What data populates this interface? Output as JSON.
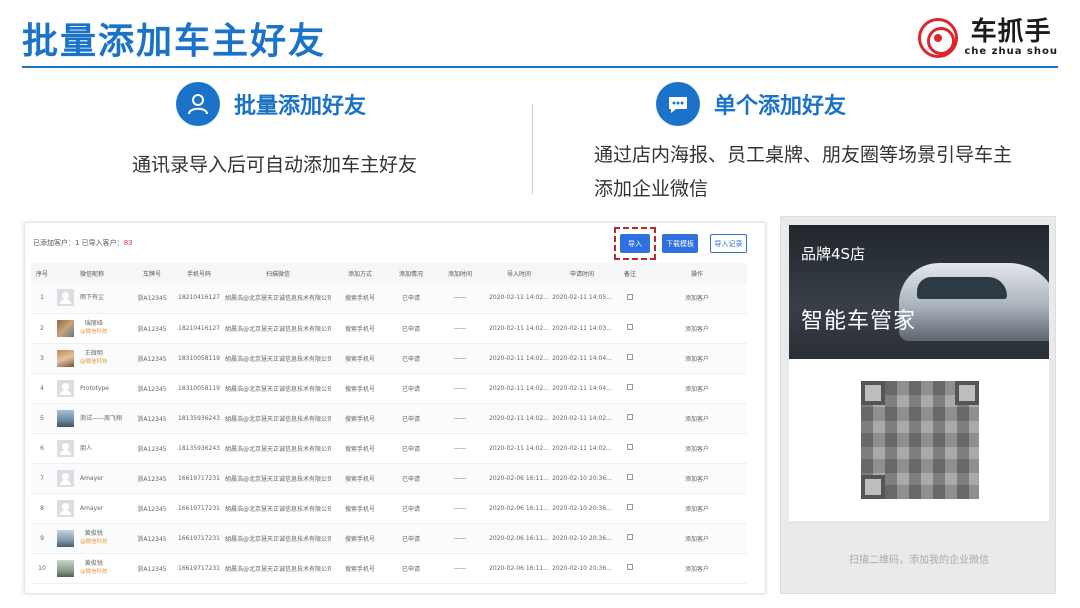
{
  "page": {
    "title": "批量添加车主好友"
  },
  "logo": {
    "name_cn": "车抓手",
    "name_en": "che zhua shou"
  },
  "features": {
    "left": {
      "title": "批量添加好友",
      "icon": "user-icon",
      "description": "通讯录导入后可自动添加车主好友"
    },
    "right": {
      "title": "单个添加好友",
      "icon": "chat-bubble-icon",
      "description": "通过店内海报、员工桌牌、朋友圈等场景引导车主添加企业微信"
    }
  },
  "panel": {
    "summary_prefix": "已添加客户：1 已导入客户：",
    "summary_count": "83",
    "buttons": {
      "import": "导入",
      "download_template": "下载模板",
      "import_record": "导入记录"
    },
    "columns": [
      "序号",
      "微信昵称",
      "车牌号",
      "手机号码",
      "扫描微信",
      "添加方式",
      "添加情况",
      "添加时间",
      "导入时间",
      "申请时间",
      "备注",
      "操作"
    ],
    "rows": [
      {
        "no": "1",
        "nickname": "雨下有尘",
        "tag": "",
        "avatar": "default",
        "plate": "浙A12345",
        "phone": "18210416127",
        "scan": "胡晨浩@北京慧天正诚信息技术有限公司",
        "method": "搜索手机号",
        "status": "已申请",
        "added": "——",
        "imported": "2020-02-11 14:02...",
        "applied": "2020-02-11 14:05...",
        "action": "添加客户"
      },
      {
        "no": "2",
        "nickname": "瑞丽娅",
        "tag": "@微信科技",
        "avatar": "photo",
        "plate": "浙A12345",
        "phone": "18210416127",
        "scan": "胡晨浩@北京慧天正诚信息技术有限公司",
        "method": "搜索手机号",
        "status": "已申请",
        "added": "——",
        "imported": "2020-02-11 14:02...",
        "applied": "2020-02-11 14:03...",
        "action": "添加客户"
      },
      {
        "no": "3",
        "nickname": "王微明",
        "tag": "@微信科技",
        "avatar": "photo2",
        "plate": "浙A12345",
        "phone": "18310058119",
        "scan": "胡晨浩@北京慧天正诚信息技术有限公司",
        "method": "搜索手机号",
        "status": "已申请",
        "added": "——",
        "imported": "2020-02-11 14:02...",
        "applied": "2020-02-11 14:04...",
        "action": "添加客户"
      },
      {
        "no": "4",
        "nickname": "Prototype",
        "tag": "",
        "avatar": "default",
        "plate": "浙A12345",
        "phone": "18310058119",
        "scan": "胡晨浩@北京慧天正诚信息技术有限公司",
        "method": "搜索手机号",
        "status": "已申请",
        "added": "——",
        "imported": "2020-02-11 14:02...",
        "applied": "2020-02-11 14:04...",
        "action": "添加客户"
      },
      {
        "no": "5",
        "nickname": "测试——周飞翔",
        "tag": "",
        "avatar": "photo3",
        "plate": "浙A12345",
        "phone": "18135936243",
        "scan": "胡晨浩@北京慧天正诚信息技术有限公司",
        "method": "搜索手机号",
        "status": "已申请",
        "added": "——",
        "imported": "2020-02-11 14:02...",
        "applied": "2020-02-11 14:02...",
        "action": "添加客户"
      },
      {
        "no": "6",
        "nickname": "朋人",
        "tag": "",
        "avatar": "default",
        "plate": "浙A12345",
        "phone": "18135936243",
        "scan": "胡晨浩@北京慧天正诚信息技术有限公司",
        "method": "搜索手机号",
        "status": "已申请",
        "added": "——",
        "imported": "2020-02-11 14:02...",
        "applied": "2020-02-11 14:02...",
        "action": "添加客户"
      },
      {
        "no": "7",
        "nickname": "Amayer",
        "tag": "",
        "avatar": "default",
        "plate": "浙A12345",
        "phone": "16619717231",
        "scan": "胡晨浩@北京慧天正诚信息技术有限公司",
        "method": "搜索手机号",
        "status": "已申请",
        "added": "——",
        "imported": "2020-02-06 16:11...",
        "applied": "2020-02-10 20:36...",
        "action": "添加客户"
      },
      {
        "no": "8",
        "nickname": "Amayer",
        "tag": "",
        "avatar": "default",
        "plate": "浙A12345",
        "phone": "16619717231",
        "scan": "胡晨浩@北京慧天正诚信息技术有限公司",
        "method": "搜索手机号",
        "status": "已申请",
        "added": "——",
        "imported": "2020-02-06 16:11...",
        "applied": "2020-02-10 20:36...",
        "action": "添加客户"
      },
      {
        "no": "9",
        "nickname": "黄俊锐",
        "tag": "@微信科技",
        "avatar": "photo4",
        "plate": "浙A12345",
        "phone": "16619717231",
        "scan": "胡晨浩@北京慧天正诚信息技术有限公司",
        "method": "搜索手机号",
        "status": "已申请",
        "added": "——",
        "imported": "2020-02-06 16:11...",
        "applied": "2020-02-10 20:36...",
        "action": "添加客户"
      },
      {
        "no": "10",
        "nickname": "黄俊锐",
        "tag": "@微信科技",
        "avatar": "photo5",
        "plate": "浙A12345",
        "phone": "16619717231",
        "scan": "胡晨浩@北京慧天正诚信息技术有限公司",
        "method": "搜索手机号",
        "status": "已申请",
        "added": "——",
        "imported": "2020-02-06 16:11...",
        "applied": "2020-02-10 20:36...",
        "action": "添加客户"
      }
    ]
  },
  "qr_card": {
    "brand_line": "品牌4S店",
    "banner_title": "智能车管家",
    "caption": "扫描二维码，添加我的企业微信"
  },
  "colors": {
    "accent": "#1a73c8",
    "button": "#2f6fe0",
    "highlight_dash": "#c0282f",
    "tag_orange": "#e89a3c"
  }
}
